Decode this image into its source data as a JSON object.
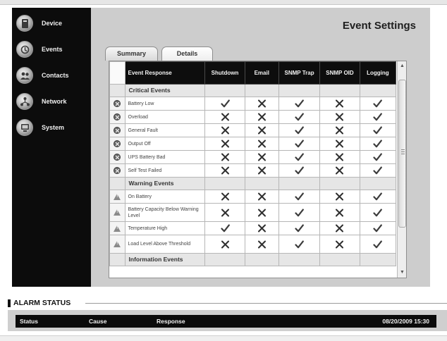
{
  "sidebar": {
    "items": [
      {
        "label": "Device",
        "icon": "device-icon"
      },
      {
        "label": "Events",
        "icon": "events-icon"
      },
      {
        "label": "Contacts",
        "icon": "contacts-icon"
      },
      {
        "label": "Network",
        "icon": "network-icon"
      },
      {
        "label": "System",
        "icon": "system-icon"
      }
    ]
  },
  "main": {
    "title": "Event Settings",
    "tabs": [
      {
        "label": "Summary",
        "active": false
      },
      {
        "label": "Details",
        "active": true
      }
    ]
  },
  "table": {
    "columns": [
      "Event Response",
      "Shutdown",
      "Email",
      "SNMP Trap",
      "SNMP OID",
      "Logging"
    ],
    "marks": {
      "check": "check-icon",
      "x": "x-icon"
    },
    "sections": [
      {
        "title": "Critical Events",
        "icon": "critical-icon",
        "rows": [
          {
            "name": "Battery Low",
            "values": [
              "check",
              "x",
              "check",
              "x",
              "check"
            ]
          },
          {
            "name": "Overload",
            "values": [
              "x",
              "x",
              "check",
              "x",
              "check"
            ]
          },
          {
            "name": "General Fault",
            "values": [
              "x",
              "x",
              "check",
              "x",
              "check"
            ]
          },
          {
            "name": "Output Off",
            "values": [
              "x",
              "x",
              "check",
              "x",
              "check"
            ]
          },
          {
            "name": "UPS Battery Bad",
            "values": [
              "x",
              "x",
              "check",
              "x",
              "check"
            ]
          },
          {
            "name": "Self Test Failed",
            "values": [
              "x",
              "x",
              "check",
              "x",
              "check"
            ]
          }
        ]
      },
      {
        "title": "Warning Events",
        "icon": "warning-icon",
        "rows": [
          {
            "name": "On Battery",
            "values": [
              "x",
              "x",
              "check",
              "x",
              "check"
            ]
          },
          {
            "name": "Battery Capacity Below Warning Level",
            "values": [
              "x",
              "x",
              "check",
              "x",
              "check"
            ]
          },
          {
            "name": "Temperature High",
            "values": [
              "check",
              "x",
              "check",
              "x",
              "check"
            ]
          },
          {
            "name": "Load Level Above Threshold",
            "values": [
              "x",
              "x",
              "check",
              "x",
              "check"
            ]
          }
        ]
      },
      {
        "title": "Information Events",
        "icon": "information-icon",
        "rows": []
      }
    ]
  },
  "alarm_status": {
    "title": "ALARM STATUS",
    "columns": {
      "status": "Status",
      "cause": "Cause",
      "response": "Response"
    },
    "timestamp": "08/20/2009 15:30"
  }
}
